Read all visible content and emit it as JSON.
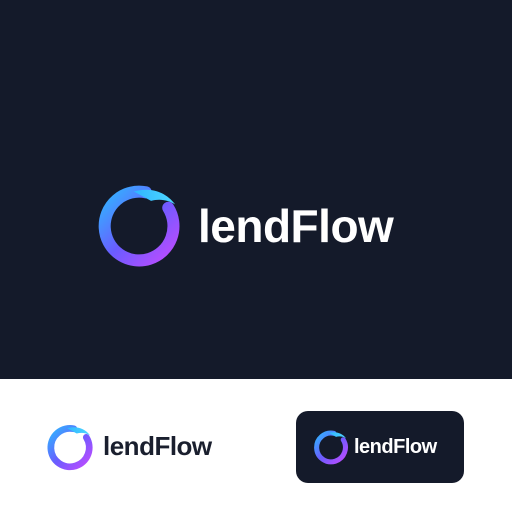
{
  "brand": {
    "name": "lendFlow",
    "colors": {
      "background_dark": "#141a2a",
      "background_light": "#ffffff",
      "gradient_start": "#2fb6ff",
      "gradient_mid": "#6a5cff",
      "gradient_end": "#c04bff",
      "text_light": "#ffffff",
      "text_dark": "#1a1f2e"
    },
    "icon": "ring-swoosh-logo-icon"
  },
  "variants": [
    {
      "id": "hero-dark",
      "wordmark": "lendFlow"
    },
    {
      "id": "horizontal-light",
      "wordmark": "lendFlow"
    },
    {
      "id": "badge-dark",
      "wordmark": "lendFlow"
    }
  ]
}
